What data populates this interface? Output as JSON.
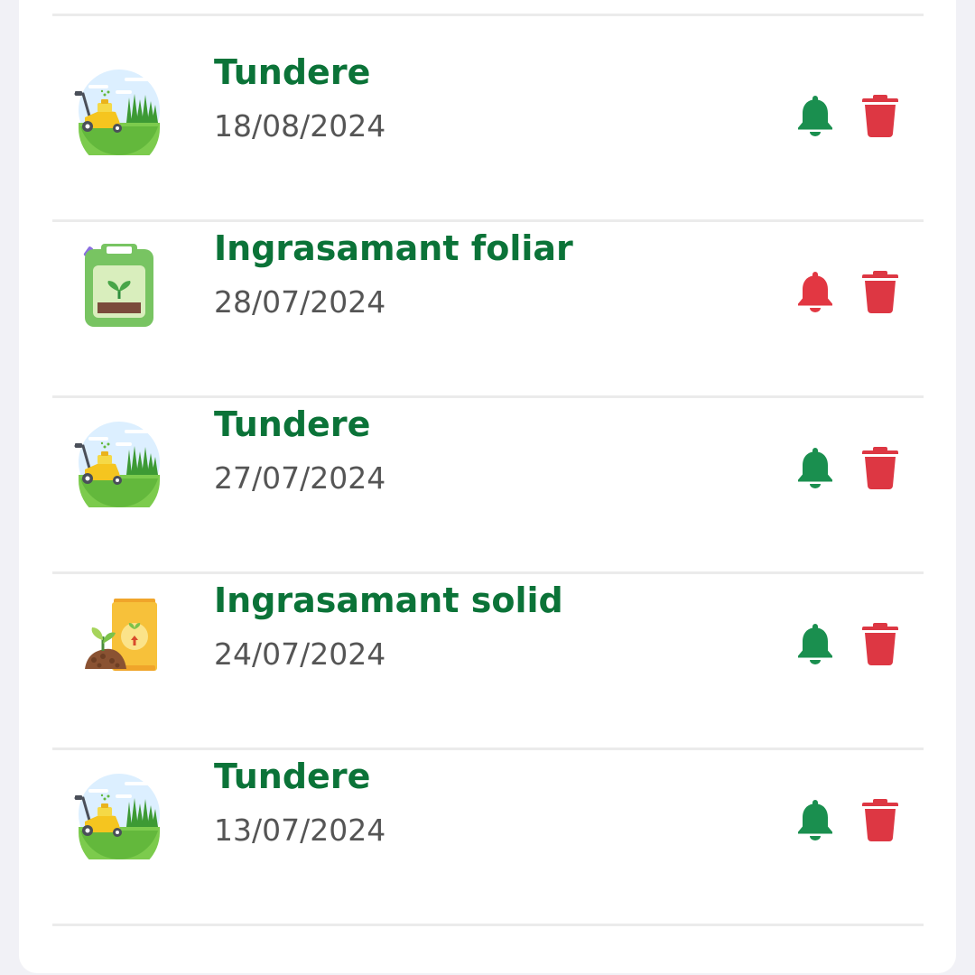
{
  "colors": {
    "title": "#0b7338",
    "date": "#555555",
    "bell_active": "#1a8f4f",
    "bell_alert": "#e23742",
    "trash": "#dd3743",
    "divider": "#ebebeb",
    "background": "#f1f1f6",
    "card": "#ffffff"
  },
  "tasks": [
    {
      "title": "Tundere",
      "date": "18/08/2024",
      "icon": "lawn-mower-icon",
      "bell": "bell-icon-green",
      "action": "trash-icon"
    },
    {
      "title": "Ingrasamant foliar",
      "date": "28/07/2024",
      "icon": "fertilizer-canister-icon",
      "bell": "bell-icon-red",
      "action": "trash-icon"
    },
    {
      "title": "Tundere",
      "date": "27/07/2024",
      "icon": "lawn-mower-icon",
      "bell": "bell-icon-green",
      "action": "trash-icon"
    },
    {
      "title": "Ingrasamant solid",
      "date": "24/07/2024",
      "icon": "fertilizer-bag-icon",
      "bell": "bell-icon-green",
      "action": "trash-icon"
    },
    {
      "title": "Tundere",
      "date": "13/07/2024",
      "icon": "lawn-mower-icon",
      "bell": "bell-icon-green",
      "action": "trash-icon"
    }
  ]
}
